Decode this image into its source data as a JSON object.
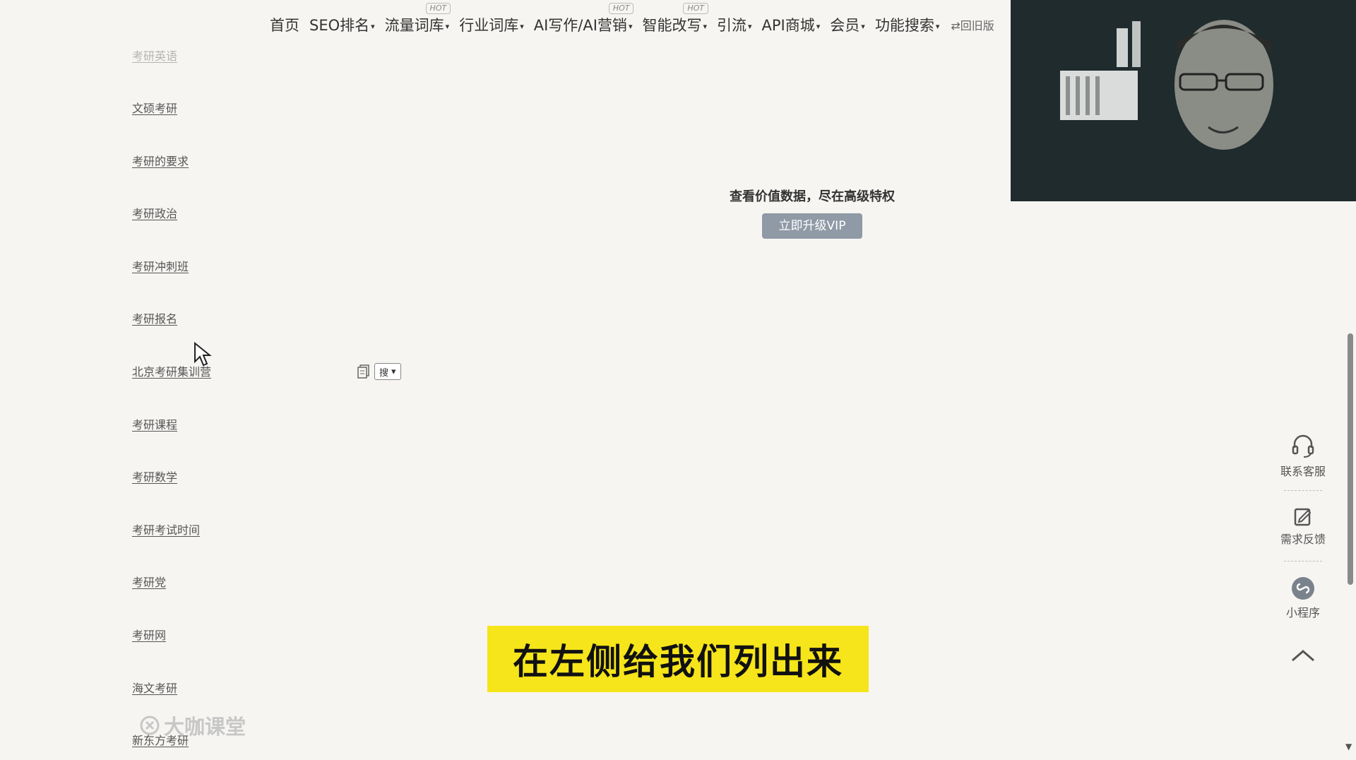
{
  "nav": {
    "items": [
      {
        "label": "首页",
        "caret": false,
        "hot": false
      },
      {
        "label": "SEO排名",
        "caret": true,
        "hot": false
      },
      {
        "label": "流量词库",
        "caret": true,
        "hot": true
      },
      {
        "label": "行业词库",
        "caret": true,
        "hot": false
      },
      {
        "label": "AI写作/AI营销",
        "caret": true,
        "hot": true
      },
      {
        "label": "智能改写",
        "caret": true,
        "hot": true
      },
      {
        "label": "引流",
        "caret": true,
        "hot": false
      },
      {
        "label": "API商城",
        "caret": true,
        "hot": false
      },
      {
        "label": "会员",
        "caret": true,
        "hot": false
      },
      {
        "label": "功能搜索",
        "caret": true,
        "hot": false
      }
    ],
    "hot_badge": "HOT",
    "old_version": "⇄回旧版"
  },
  "keywords": [
    "文硕考研",
    "考研的要求",
    "考研政治",
    "考研冲刺班",
    "考研报名",
    "北京考研集训营",
    "考研课程",
    "考研数学",
    "考研考试时间",
    "考研党",
    "考研网",
    "海文考研",
    "新东方考研"
  ],
  "row_tools": {
    "search_label": "搜"
  },
  "vip": {
    "title": "查看价值数据，尽在高级特权",
    "button": "立即升级VIP"
  },
  "side_tools": {
    "contact": "联系客服",
    "feedback": "需求反馈",
    "miniprogram": "小程序"
  },
  "subtitle": "在左侧给我们列出来",
  "brand": "大咖课堂"
}
